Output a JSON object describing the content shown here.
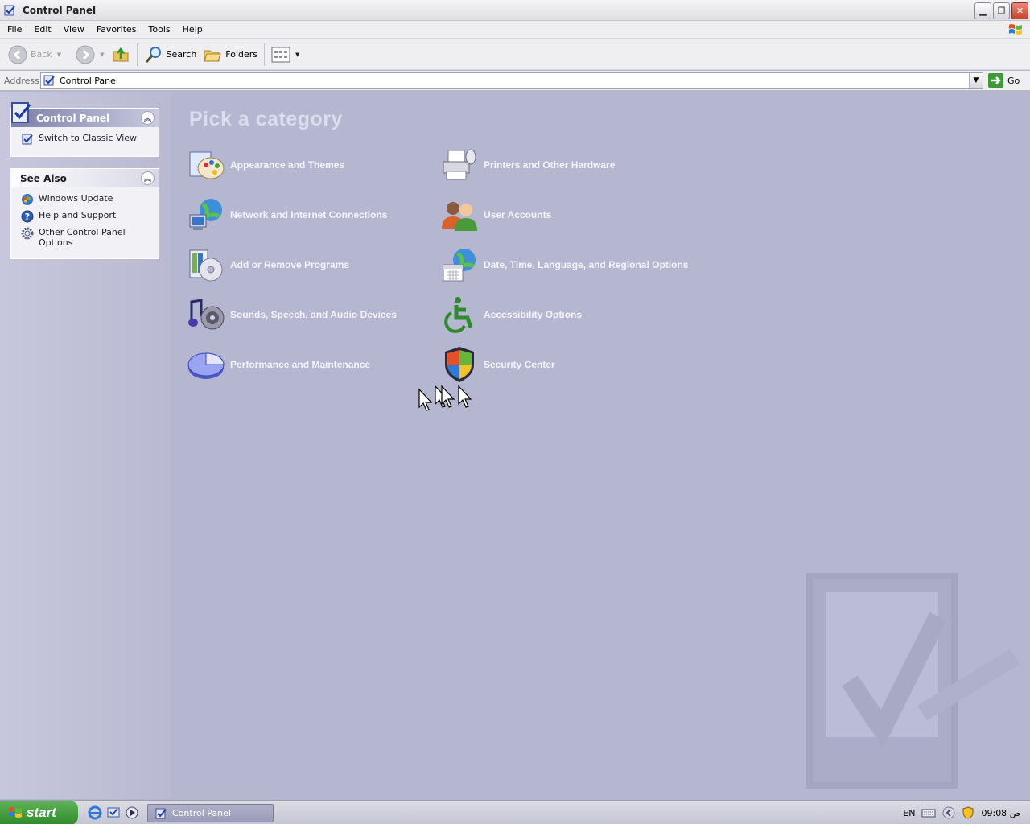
{
  "window": {
    "title": "Control Panel"
  },
  "menu": [
    "File",
    "Edit",
    "View",
    "Favorites",
    "Tools",
    "Help"
  ],
  "toolbar": {
    "back": "Back",
    "search": "Search",
    "folders": "Folders"
  },
  "address": {
    "label": "Address",
    "value": "Control Panel",
    "go": "Go"
  },
  "left": {
    "control_panel": {
      "title": "Control Panel",
      "switch": "Switch to Classic View"
    },
    "see_also": {
      "title": "See Also",
      "items": [
        "Windows Update",
        "Help and Support",
        "Other Control Panel Options"
      ]
    }
  },
  "main": {
    "heading": "Pick a category",
    "categories_left": [
      "Appearance and Themes",
      "Network and Internet Connections",
      "Add or Remove Programs",
      "Sounds, Speech, and Audio Devices",
      "Performance and Maintenance"
    ],
    "categories_right": [
      "Printers and Other Hardware",
      "User Accounts",
      "Date, Time, Language, and Regional Options",
      "Accessibility Options",
      "Security Center"
    ]
  },
  "taskbar": {
    "start": "start",
    "task": "Control Panel",
    "lang": "EN",
    "clock": "09:08 ص"
  },
  "colors": {
    "background": "#b5b6d0",
    "accent": "#7b7fa8",
    "start_green": "#3e9a38"
  }
}
